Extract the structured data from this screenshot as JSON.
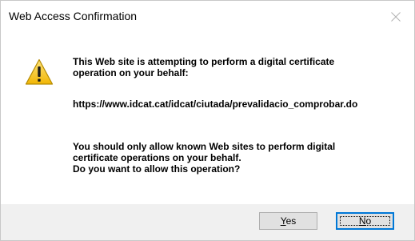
{
  "window": {
    "title": "Web Access Confirmation"
  },
  "icons": {
    "warning": "warning-icon",
    "close": "close-icon"
  },
  "message": {
    "line1_a": "This Web site is attempting to perform a digital certificate",
    "line1_b": "operation on your behalf:",
    "url": "https://www.idcat.cat/idcat/ciutada/prevalidacio_comprobar.do",
    "line3_a": "You should only allow known Web sites to perform digital",
    "line3_b": "certificate operations on your behalf.",
    "line3_c": "Do you want to allow this operation?"
  },
  "buttons": {
    "yes_accel": "Y",
    "yes_rest": "es",
    "no_accel": "N",
    "no_rest": "o"
  },
  "colors": {
    "focus_border": "#0078d7",
    "warning_fill": "#f5c518",
    "dialog_bg": "#f0f0f0"
  }
}
